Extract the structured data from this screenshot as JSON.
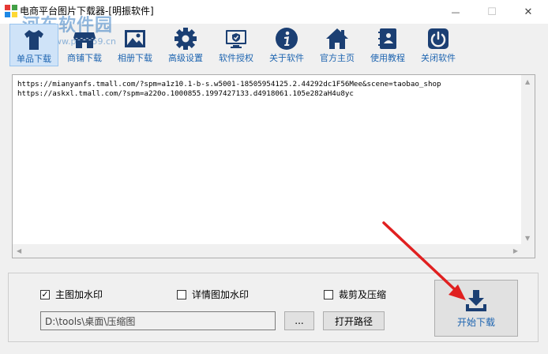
{
  "window": {
    "title": "电商平台图片下载器-[明振软件]",
    "minimize_glyph": "—",
    "maximize_glyph": "☐",
    "close_glyph": "✕"
  },
  "watermark": {
    "text": "河东软件园",
    "url": "www.pc0359.cn"
  },
  "toolbar": {
    "active_index": 0,
    "items": [
      {
        "label": "单品下载",
        "icon": "shirt-icon"
      },
      {
        "label": "商铺下载",
        "icon": "store-icon"
      },
      {
        "label": "相册下载",
        "icon": "photo-album-icon"
      },
      {
        "label": "高级设置",
        "icon": "gear-icon"
      },
      {
        "label": "软件授权",
        "icon": "monitor-shield-icon"
      },
      {
        "label": "关于软件",
        "icon": "info-icon"
      },
      {
        "label": "官方主页",
        "icon": "home-icon"
      },
      {
        "label": "使用教程",
        "icon": "address-book-icon"
      },
      {
        "label": "关闭软件",
        "icon": "power-icon"
      }
    ],
    "accent": "#1d64b0"
  },
  "urls": [
    "https://mianyanfs.tmall.com/?spm=a1z10.1-b-s.w5001-18505954125.2.44292dc1F56Mee&scene=taobao_shop",
    "https://askxl.tmall.com/?spm=a220o.1000855.1997427133.d4918061.105e282aH4u8yc"
  ],
  "options": {
    "main_watermark": {
      "label": "主图加水印",
      "checked": true
    },
    "detail_watermark": {
      "label": "详情图加水印",
      "checked": false
    },
    "crop_compress": {
      "label": "裁剪及压缩",
      "checked": false
    }
  },
  "output": {
    "path_value": "D:\\tools\\桌面\\压缩图",
    "browse_label": "...",
    "open_path_label": "打开路径",
    "start_label": "开始下载"
  }
}
